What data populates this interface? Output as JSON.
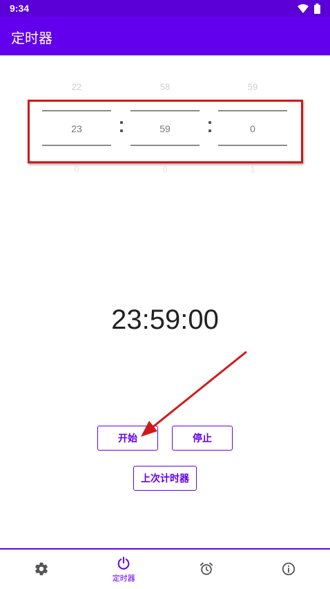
{
  "status_bar": {
    "time": "9:34"
  },
  "app_bar": {
    "title": "定时器"
  },
  "picker": {
    "hours": {
      "prev": "22",
      "current": "23",
      "next": "0"
    },
    "minutes": {
      "prev": "58",
      "current": "59",
      "next": "0"
    },
    "seconds": {
      "prev": "59",
      "current": "0",
      "next": "1"
    }
  },
  "timer_display": "23:59:00",
  "buttons": {
    "start": "开始",
    "stop": "停止",
    "last_timer": "上次计时器"
  },
  "bottom_nav": {
    "items": [
      {
        "icon": "gear-icon",
        "label": ""
      },
      {
        "icon": "power-icon",
        "label": "定时器",
        "active": true
      },
      {
        "icon": "alarm-clock-icon",
        "label": ""
      },
      {
        "icon": "info-icon",
        "label": ""
      }
    ]
  },
  "colors": {
    "primary": "#6200ee",
    "status_bar": "#5b00d6",
    "annotation": "#d21818"
  }
}
